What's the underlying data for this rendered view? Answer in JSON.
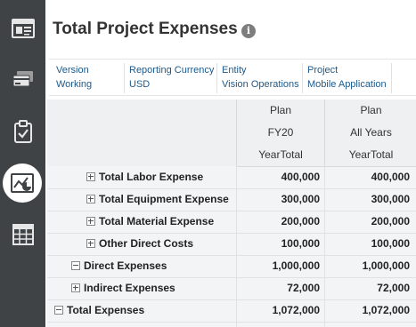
{
  "header": {
    "title": "Total Project Expenses",
    "info_glyph": "i"
  },
  "rail": {
    "items": [
      {
        "icon": "dashboard-icon"
      },
      {
        "icon": "expense-cards-icon"
      },
      {
        "icon": "clipboard-check-icon"
      },
      {
        "icon": "chart-report-icon",
        "active": true
      },
      {
        "icon": "grid-table-icon"
      }
    ]
  },
  "pov": [
    {
      "label": "Version",
      "value": "Working"
    },
    {
      "label": "Reporting Currency",
      "value": "USD"
    },
    {
      "label": "Entity",
      "value": "Vision Operations"
    },
    {
      "label": "Project",
      "value": "Mobile Application"
    }
  ],
  "columns": [
    {
      "scenario": "Plan",
      "year": "FY20",
      "period": "YearTotal"
    },
    {
      "scenario": "Plan",
      "year": "All Years",
      "period": "YearTotal"
    }
  ],
  "rows": [
    {
      "label": "Total Labor Expense",
      "toggle": "+",
      "level": 2,
      "values": [
        "400,000",
        "400,000"
      ]
    },
    {
      "label": "Total Equipment Expense",
      "toggle": "+",
      "level": 2,
      "values": [
        "300,000",
        "300,000"
      ]
    },
    {
      "label": "Total Material Expense",
      "toggle": "+",
      "level": 2,
      "values": [
        "200,000",
        "200,000"
      ]
    },
    {
      "label": "Other Direct Costs",
      "toggle": "+",
      "level": 2,
      "values": [
        "100,000",
        "100,000"
      ]
    },
    {
      "label": "Direct Expenses",
      "toggle": "-",
      "level": 1,
      "values": [
        "1,000,000",
        "1,000,000"
      ]
    },
    {
      "label": "Indirect Expenses",
      "toggle": "+",
      "level": 1,
      "values": [
        "72,000",
        "72,000"
      ]
    },
    {
      "label": "Total Expenses",
      "toggle": "-",
      "level": 0,
      "values": [
        "1,072,000",
        "1,072,000"
      ]
    }
  ],
  "colors": {
    "rail": "#3f4346",
    "link": "#1c5a8c",
    "title": "#333333"
  }
}
